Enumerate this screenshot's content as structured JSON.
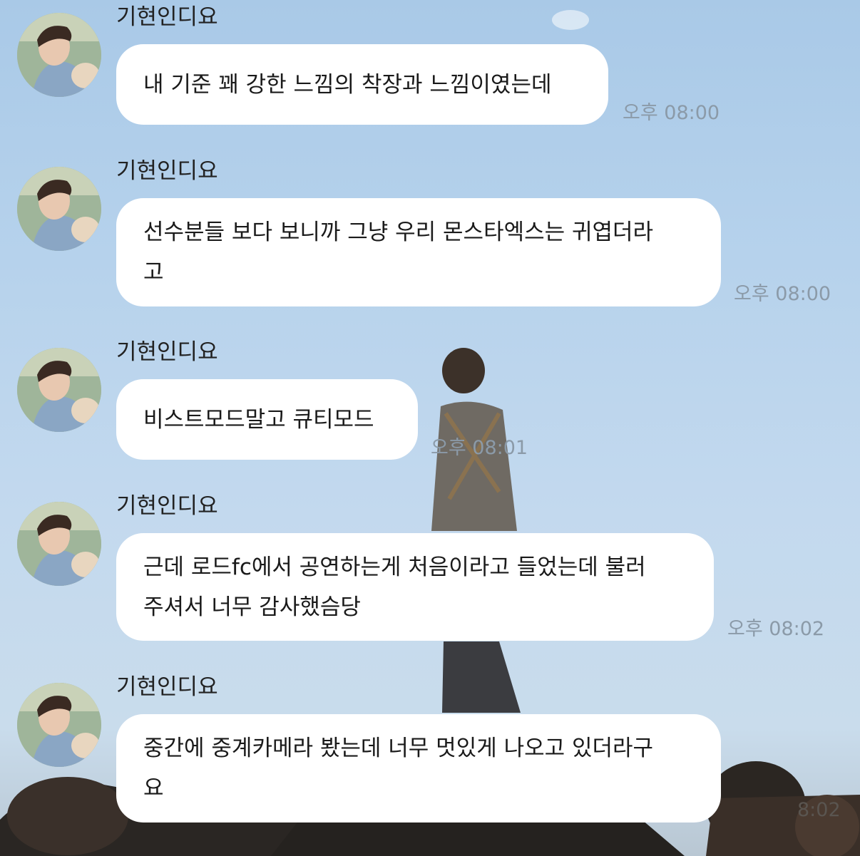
{
  "messages": [
    {
      "sender": "기현인디요",
      "text": "내 기준 꽤 강한 느낌의 착장과 느낌이였는데",
      "time": "오후 08:00"
    },
    {
      "sender": "기현인디요",
      "text": "선수분들 보다 보니까 그냥 우리 몬스타엑스는 귀엽더라\n고",
      "time": "오후 08:00"
    },
    {
      "sender": "기현인디요",
      "text": "비스트모드말고 큐티모드",
      "time": "오후 08:01"
    },
    {
      "sender": "기현인디요",
      "text": "근데 로드fc에서 공연하는게 처음이라고 들었는데 불러\n주셔서 너무 감사했슴당",
      "time": "오후 08:02"
    },
    {
      "sender": "기현인디요",
      "text": "중간에 중계카메라 봤는데 너무 멋있게 나오고 있더라구\n요",
      "time": "8:02"
    }
  ],
  "colors": {
    "bubble": "#ffffff",
    "time_text": "#8b9aa8",
    "sky_top": "#a9c9e7"
  }
}
